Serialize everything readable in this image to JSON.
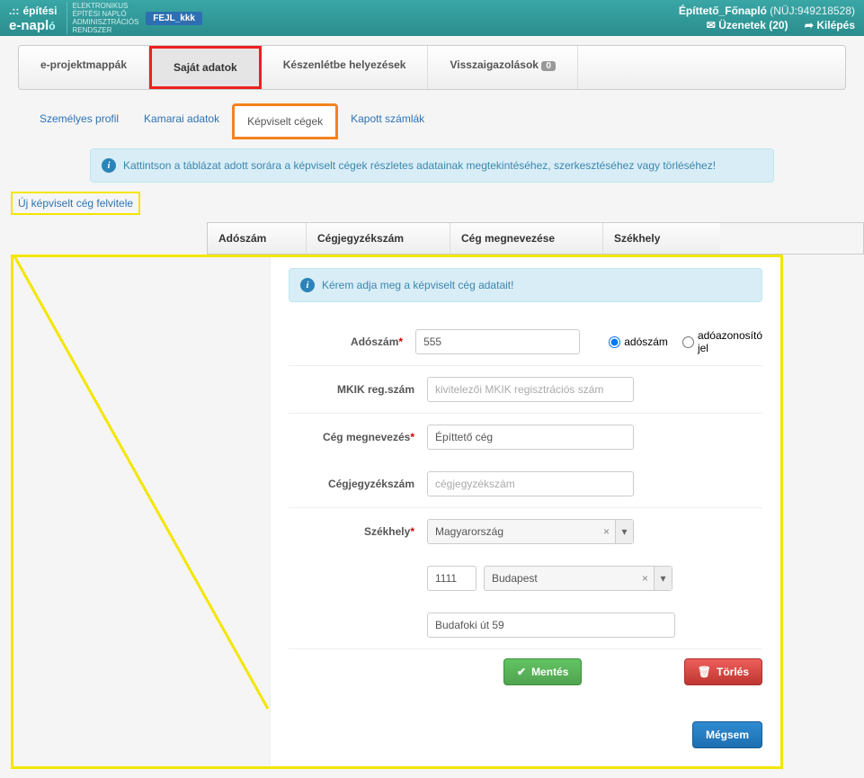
{
  "header": {
    "brand_line1": "építési",
    "brand_line2": "e-napló",
    "brand_sub": "ELEKTRONIKUS\nÉPÍTÉSI NAPLÓ\nADMINISZTRÁCIÓS\nRENDSZER",
    "env_badge": "FEJL_kkk",
    "user_name": "Építtető_Főnapló",
    "nuj": "(NÜJ:949218528)",
    "messages": "Üzenetek (20)",
    "logout": "Kilépés"
  },
  "maintabs": {
    "t1": "e-projektmappák",
    "t2": "Saját adatok",
    "t3": "Készenlétbe helyezések",
    "t4": "Visszaigazolások",
    "t4_badge": "0"
  },
  "subtabs": {
    "s1": "Személyes profil",
    "s2": "Kamarai adatok",
    "s3": "Képviselt cégek",
    "s4": "Kapott számlák"
  },
  "alert1": "Kattintson a táblázat adott sorára a képviselt cégek részletes adatainak megtekintéséhez, szerkesztéséhez vagy törléséhez!",
  "new_link": "Új képviselt cég felvitele",
  "table": {
    "h1": "Adószám",
    "h2": "Cégjegyzékszám",
    "h3": "Cég megnevezése",
    "h4": "Székhely"
  },
  "alert2": "Kérem adja meg a képviselt cég adatait!",
  "form": {
    "adoszam_label": "Adószám",
    "adoszam_value": "555",
    "radio_adoszam": "adószám",
    "radio_adoazon": "adóazonosító jel",
    "mkik_label": "MKIK reg.szám",
    "mkik_placeholder": "kivitelezői MKIK regisztrációs szám",
    "cegnev_label": "Cég megnevezés",
    "cegnev_value": "Építtető cég",
    "cegjegyz_label": "Cégjegyzékszám",
    "cegjegyz_placeholder": "cégjegyzékszám",
    "szekhely_label": "Székhely",
    "country": "Magyarország",
    "zip": "1111",
    "city": "Budapest",
    "street": "Budafoki út 59"
  },
  "buttons": {
    "save": "Mentés",
    "delete": "Törlés",
    "cancel": "Mégsem"
  }
}
